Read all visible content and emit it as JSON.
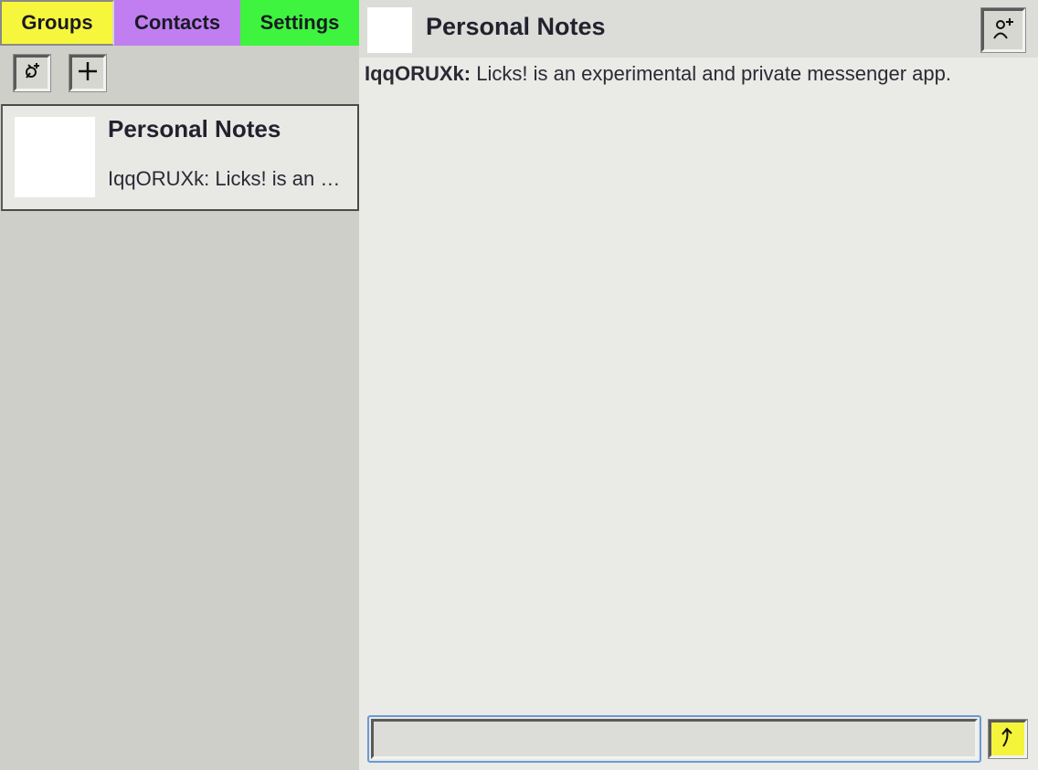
{
  "tabs": {
    "groups": {
      "label": "Groups",
      "color": "#f6f63c"
    },
    "contacts": {
      "label": "Contacts",
      "color": "#c07ef0"
    },
    "settings": {
      "label": "Settings",
      "color": "#3ef43e"
    }
  },
  "toolbar": {
    "left_icon": "add-group-icon",
    "right_icon": "plus-icon"
  },
  "chat_list": [
    {
      "title": "Personal Notes",
      "preview": "IqqORUXk: Licks! is an experimental and private messenger app."
    }
  ],
  "conversation": {
    "title": "Personal Notes",
    "header_icon": "add-member-icon",
    "messages": [
      {
        "sender": "IqqORUXk:",
        "text": " Licks! is an experimental and private messenger app."
      }
    ]
  },
  "composer": {
    "value": "",
    "send_icon": "send-arrow-icon",
    "send_color": "#f4f43a"
  }
}
